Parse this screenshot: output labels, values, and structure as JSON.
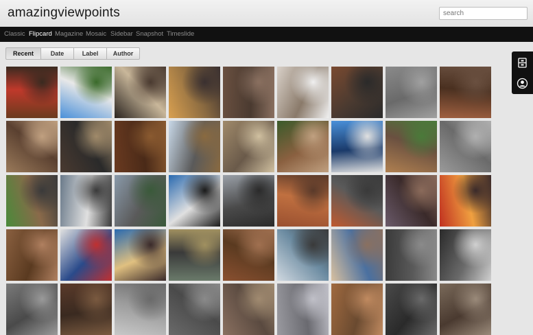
{
  "header": {
    "site_title": "amazingviewpoints",
    "search_placeholder": "search"
  },
  "nav": {
    "items": [
      {
        "label": "Classic",
        "active": false
      },
      {
        "label": "Flipcard",
        "active": true
      },
      {
        "label": "Magazine",
        "active": false
      },
      {
        "label": "Mosaic",
        "active": false
      },
      {
        "label": "Sidebar",
        "active": false
      },
      {
        "label": "Snapshot",
        "active": false
      },
      {
        "label": "Timeslide",
        "active": false
      }
    ]
  },
  "sort_tabs": {
    "items": [
      {
        "label": "Recent",
        "active": true
      },
      {
        "label": "Date",
        "active": false
      },
      {
        "label": "Label",
        "active": false
      },
      {
        "label": "Author",
        "active": false
      }
    ]
  },
  "side_widget": {
    "icons": [
      "share-icon",
      "profile-icon"
    ]
  },
  "photo_grid": {
    "rows": [
      [
        {
          "subject": "wooden door frame with red poster",
          "colors": [
            "#6b3a1e",
            "#c0392b",
            "#3a2a20"
          ]
        },
        {
          "subject": "two-storey white house with blue sky",
          "colors": [
            "#4a90d9",
            "#e8e8e8",
            "#3a6a2a"
          ]
        },
        {
          "subject": "dark doorway interior",
          "colors": [
            "#2a2420",
            "#c9b79a",
            "#4a3a30"
          ]
        },
        {
          "subject": "paint buckets on floor",
          "colors": [
            "#d9a050",
            "#8a6a40",
            "#3a3030"
          ]
        },
        {
          "subject": "stacked wood planks",
          "colors": [
            "#6a5040",
            "#4a3a30",
            "#8a7060"
          ]
        },
        {
          "subject": "window frame on wall",
          "colors": [
            "#d8d0c8",
            "#8a7a6a",
            "#f0f0f0"
          ]
        },
        {
          "subject": "iron rods on ground",
          "colors": [
            "#7a4a30",
            "#4a3a30",
            "#2a2a2a"
          ]
        },
        {
          "subject": "grey concrete gravel",
          "colors": [
            "#8a8a8a",
            "#6a6a6a",
            "#a0a0a0"
          ]
        },
        {
          "subject": "reinforcement grid foundation",
          "colors": [
            "#a06040",
            "#4a3020",
            "#6a5040"
          ]
        }
      ],
      [
        {
          "subject": "foundation trenches",
          "colors": [
            "#9a7a5a",
            "#5a4030",
            "#c0a080"
          ]
        },
        {
          "subject": "steel reinforcement cage",
          "colors": [
            "#4a3a30",
            "#2a2a2a",
            "#a08a6a"
          ]
        },
        {
          "subject": "pile of stones",
          "colors": [
            "#6a3a20",
            "#4a2a18",
            "#8a5a30"
          ]
        },
        {
          "subject": "excavator with gravel heap",
          "colors": [
            "#c8d8e8",
            "#5a5a5a",
            "#8a6a40"
          ]
        },
        {
          "subject": "block walls rising",
          "colors": [
            "#a08a6a",
            "#6a5a4a",
            "#d0c0a0"
          ]
        },
        {
          "subject": "site with trees",
          "colors": [
            "#3a5a2a",
            "#8a6040",
            "#c0a080"
          ]
        },
        {
          "subject": "blue and white building",
          "colors": [
            "#4a90d9",
            "#1a3a6a",
            "#e0e0e0"
          ]
        },
        {
          "subject": "sand and blocks on site",
          "colors": [
            "#b08050",
            "#6a5040",
            "#4a7a3a"
          ]
        },
        {
          "subject": "stacked hollow blocks",
          "colors": [
            "#9a9a9a",
            "#6a6a6a",
            "#b0b0b0"
          ]
        }
      ],
      [
        {
          "subject": "building with green grass",
          "colors": [
            "#4a8a3a",
            "#8a6a4a",
            "#3a3a3a"
          ]
        },
        {
          "subject": "signboard",
          "colors": [
            "#6a7a8a",
            "#e0e0e0",
            "#3a3a3a"
          ]
        },
        {
          "subject": "road through hills",
          "colors": [
            "#8a9aaa",
            "#5a5a5a",
            "#3a5a3a"
          ]
        },
        {
          "subject": "blue banner",
          "colors": [
            "#2a6ab0",
            "#e0e0e0",
            "#1a1a1a"
          ]
        },
        {
          "subject": "street with cloudy sky",
          "colors": [
            "#9aa0a8",
            "#4a4a4a",
            "#2a2a2a"
          ]
        },
        {
          "subject": "brown apartment building",
          "colors": [
            "#9a5030",
            "#c07040",
            "#5a3a2a"
          ]
        },
        {
          "subject": "truck and building",
          "colors": [
            "#c05a30",
            "#5a5a5a",
            "#3a3a3a"
          ]
        },
        {
          "subject": "street at dusk",
          "colors": [
            "#6a5a6a",
            "#3a2a2a",
            "#8a6a5a"
          ]
        },
        {
          "subject": "crowd in red tent",
          "colors": [
            "#c03020",
            "#f0a040",
            "#3a2a2a"
          ]
        }
      ],
      [
        {
          "subject": "excavated soil",
          "colors": [
            "#8a6040",
            "#5a3a20",
            "#b08060"
          ]
        },
        {
          "subject": "notice board sign",
          "colors": [
            "#e0e0e0",
            "#2a4a8a",
            "#c03030"
          ]
        },
        {
          "subject": "people at event",
          "colors": [
            "#2a6ab0",
            "#e0c080",
            "#3a2a2a"
          ]
        },
        {
          "subject": "busy street",
          "colors": [
            "#6a7a6a",
            "#3a3a3a",
            "#a09060"
          ]
        },
        {
          "subject": "cleared land",
          "colors": [
            "#8a5030",
            "#5a3a20",
            "#a07050"
          ]
        },
        {
          "subject": "white building",
          "colors": [
            "#d0d8e0",
            "#6a8aa0",
            "#3a3a3a"
          ]
        },
        {
          "subject": "cream building with windows",
          "colors": [
            "#d8c0a0",
            "#4a70a0",
            "#8a7060"
          ]
        },
        {
          "subject": "floor plan blueprint",
          "colors": [
            "#3a3a3a",
            "#5a5a5a",
            "#8a8a8a"
          ]
        },
        {
          "subject": "dark interior room",
          "colors": [
            "#2a2a2a",
            "#6a6a6a",
            "#d0d0d0"
          ]
        }
      ],
      [
        {
          "subject": "partial tile",
          "colors": [
            "#7a7a7a",
            "#4a4a4a",
            "#9a9a9a"
          ]
        },
        {
          "subject": "partial tile",
          "colors": [
            "#5a3a2a",
            "#3a2a20",
            "#7a5a40"
          ]
        },
        {
          "subject": "partial tile",
          "colors": [
            "#c8c8c8",
            "#9a9a9a",
            "#6a6a6a"
          ]
        },
        {
          "subject": "partial tile",
          "colors": [
            "#6a6a6a",
            "#4a4a4a",
            "#8a8a8a"
          ]
        },
        {
          "subject": "partial tile",
          "colors": [
            "#8a7060",
            "#5a4a40",
            "#a08a70"
          ]
        },
        {
          "subject": "partial tile",
          "colors": [
            "#9a9aa0",
            "#6a6a70",
            "#c0c0c8"
          ]
        },
        {
          "subject": "partial tile",
          "colors": [
            "#a06a40",
            "#6a4a30",
            "#c08a60"
          ]
        },
        {
          "subject": "partial tile",
          "colors": [
            "#4a4a4a",
            "#2a2a2a",
            "#6a6a6a"
          ]
        },
        {
          "subject": "partial tile",
          "colors": [
            "#7a6a5a",
            "#4a3a30",
            "#9a8a7a"
          ]
        }
      ]
    ]
  }
}
